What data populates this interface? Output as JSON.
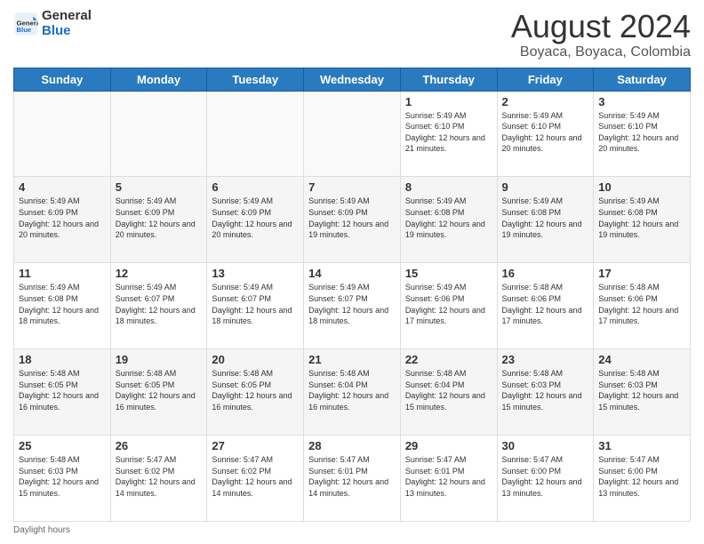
{
  "header": {
    "logo_line1": "General",
    "logo_line2": "Blue",
    "month_year": "August 2024",
    "location": "Boyaca, Boyaca, Colombia"
  },
  "days_of_week": [
    "Sunday",
    "Monday",
    "Tuesday",
    "Wednesday",
    "Thursday",
    "Friday",
    "Saturday"
  ],
  "weeks": [
    [
      {
        "day": "",
        "sunrise": "",
        "sunset": "",
        "daylight": ""
      },
      {
        "day": "",
        "sunrise": "",
        "sunset": "",
        "daylight": ""
      },
      {
        "day": "",
        "sunrise": "",
        "sunset": "",
        "daylight": ""
      },
      {
        "day": "",
        "sunrise": "",
        "sunset": "",
        "daylight": ""
      },
      {
        "day": "1",
        "sunrise": "Sunrise: 5:49 AM",
        "sunset": "Sunset: 6:10 PM",
        "daylight": "Daylight: 12 hours and 21 minutes."
      },
      {
        "day": "2",
        "sunrise": "Sunrise: 5:49 AM",
        "sunset": "Sunset: 6:10 PM",
        "daylight": "Daylight: 12 hours and 20 minutes."
      },
      {
        "day": "3",
        "sunrise": "Sunrise: 5:49 AM",
        "sunset": "Sunset: 6:10 PM",
        "daylight": "Daylight: 12 hours and 20 minutes."
      }
    ],
    [
      {
        "day": "4",
        "sunrise": "Sunrise: 5:49 AM",
        "sunset": "Sunset: 6:09 PM",
        "daylight": "Daylight: 12 hours and 20 minutes."
      },
      {
        "day": "5",
        "sunrise": "Sunrise: 5:49 AM",
        "sunset": "Sunset: 6:09 PM",
        "daylight": "Daylight: 12 hours and 20 minutes."
      },
      {
        "day": "6",
        "sunrise": "Sunrise: 5:49 AM",
        "sunset": "Sunset: 6:09 PM",
        "daylight": "Daylight: 12 hours and 20 minutes."
      },
      {
        "day": "7",
        "sunrise": "Sunrise: 5:49 AM",
        "sunset": "Sunset: 6:09 PM",
        "daylight": "Daylight: 12 hours and 19 minutes."
      },
      {
        "day": "8",
        "sunrise": "Sunrise: 5:49 AM",
        "sunset": "Sunset: 6:08 PM",
        "daylight": "Daylight: 12 hours and 19 minutes."
      },
      {
        "day": "9",
        "sunrise": "Sunrise: 5:49 AM",
        "sunset": "Sunset: 6:08 PM",
        "daylight": "Daylight: 12 hours and 19 minutes."
      },
      {
        "day": "10",
        "sunrise": "Sunrise: 5:49 AM",
        "sunset": "Sunset: 6:08 PM",
        "daylight": "Daylight: 12 hours and 19 minutes."
      }
    ],
    [
      {
        "day": "11",
        "sunrise": "Sunrise: 5:49 AM",
        "sunset": "Sunset: 6:08 PM",
        "daylight": "Daylight: 12 hours and 18 minutes."
      },
      {
        "day": "12",
        "sunrise": "Sunrise: 5:49 AM",
        "sunset": "Sunset: 6:07 PM",
        "daylight": "Daylight: 12 hours and 18 minutes."
      },
      {
        "day": "13",
        "sunrise": "Sunrise: 5:49 AM",
        "sunset": "Sunset: 6:07 PM",
        "daylight": "Daylight: 12 hours and 18 minutes."
      },
      {
        "day": "14",
        "sunrise": "Sunrise: 5:49 AM",
        "sunset": "Sunset: 6:07 PM",
        "daylight": "Daylight: 12 hours and 18 minutes."
      },
      {
        "day": "15",
        "sunrise": "Sunrise: 5:49 AM",
        "sunset": "Sunset: 6:06 PM",
        "daylight": "Daylight: 12 hours and 17 minutes."
      },
      {
        "day": "16",
        "sunrise": "Sunrise: 5:48 AM",
        "sunset": "Sunset: 6:06 PM",
        "daylight": "Daylight: 12 hours and 17 minutes."
      },
      {
        "day": "17",
        "sunrise": "Sunrise: 5:48 AM",
        "sunset": "Sunset: 6:06 PM",
        "daylight": "Daylight: 12 hours and 17 minutes."
      }
    ],
    [
      {
        "day": "18",
        "sunrise": "Sunrise: 5:48 AM",
        "sunset": "Sunset: 6:05 PM",
        "daylight": "Daylight: 12 hours and 16 minutes."
      },
      {
        "day": "19",
        "sunrise": "Sunrise: 5:48 AM",
        "sunset": "Sunset: 6:05 PM",
        "daylight": "Daylight: 12 hours and 16 minutes."
      },
      {
        "day": "20",
        "sunrise": "Sunrise: 5:48 AM",
        "sunset": "Sunset: 6:05 PM",
        "daylight": "Daylight: 12 hours and 16 minutes."
      },
      {
        "day": "21",
        "sunrise": "Sunrise: 5:48 AM",
        "sunset": "Sunset: 6:04 PM",
        "daylight": "Daylight: 12 hours and 16 minutes."
      },
      {
        "day": "22",
        "sunrise": "Sunrise: 5:48 AM",
        "sunset": "Sunset: 6:04 PM",
        "daylight": "Daylight: 12 hours and 15 minutes."
      },
      {
        "day": "23",
        "sunrise": "Sunrise: 5:48 AM",
        "sunset": "Sunset: 6:03 PM",
        "daylight": "Daylight: 12 hours and 15 minutes."
      },
      {
        "day": "24",
        "sunrise": "Sunrise: 5:48 AM",
        "sunset": "Sunset: 6:03 PM",
        "daylight": "Daylight: 12 hours and 15 minutes."
      }
    ],
    [
      {
        "day": "25",
        "sunrise": "Sunrise: 5:48 AM",
        "sunset": "Sunset: 6:03 PM",
        "daylight": "Daylight: 12 hours and 15 minutes."
      },
      {
        "day": "26",
        "sunrise": "Sunrise: 5:47 AM",
        "sunset": "Sunset: 6:02 PM",
        "daylight": "Daylight: 12 hours and 14 minutes."
      },
      {
        "day": "27",
        "sunrise": "Sunrise: 5:47 AM",
        "sunset": "Sunset: 6:02 PM",
        "daylight": "Daylight: 12 hours and 14 minutes."
      },
      {
        "day": "28",
        "sunrise": "Sunrise: 5:47 AM",
        "sunset": "Sunset: 6:01 PM",
        "daylight": "Daylight: 12 hours and 14 minutes."
      },
      {
        "day": "29",
        "sunrise": "Sunrise: 5:47 AM",
        "sunset": "Sunset: 6:01 PM",
        "daylight": "Daylight: 12 hours and 13 minutes."
      },
      {
        "day": "30",
        "sunrise": "Sunrise: 5:47 AM",
        "sunset": "Sunset: 6:00 PM",
        "daylight": "Daylight: 12 hours and 13 minutes."
      },
      {
        "day": "31",
        "sunrise": "Sunrise: 5:47 AM",
        "sunset": "Sunset: 6:00 PM",
        "daylight": "Daylight: 12 hours and 13 minutes."
      }
    ]
  ],
  "footer": {
    "note": "Daylight hours"
  }
}
